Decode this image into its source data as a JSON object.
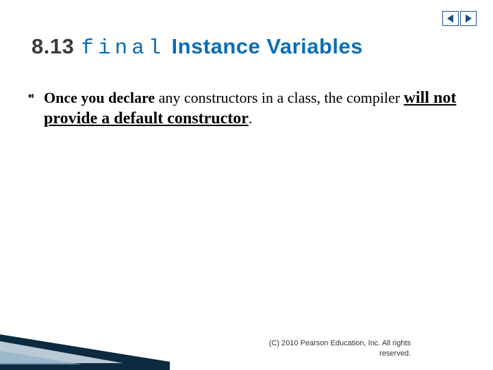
{
  "nav": {
    "prev_label": "Previous slide",
    "next_label": "Next slide"
  },
  "title": {
    "section_number": "8.13",
    "final_keyword": "final",
    "rest": "Instance Variables"
  },
  "bullet": {
    "lead_bold": "Once you declare",
    "mid_plain": " any constructors in a class, the compiler ",
    "underlined": "will not provide a default constructor",
    "tail": "."
  },
  "footer": {
    "copyright": "(C) 2010 Pearson Education, Inc. All rights reserved."
  }
}
